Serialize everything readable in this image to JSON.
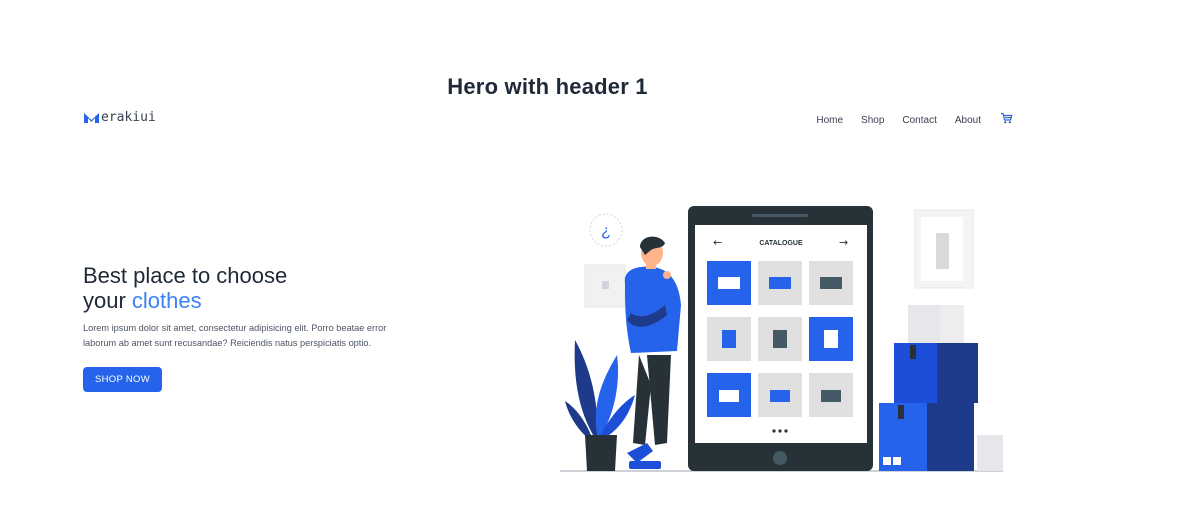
{
  "page": {
    "title": "Hero with header 1"
  },
  "brand": {
    "name_rest": "erakiui",
    "color": "#2563eb"
  },
  "nav": {
    "links": [
      "Home",
      "Shop",
      "Contact",
      "About"
    ],
    "cart_icon": "cart-icon"
  },
  "hero": {
    "headline_line1": "Best place to choose",
    "headline_word": "your",
    "headline_accent": "clothes",
    "description": "Lorem ipsum dolor sit amet, consectetur adipisicing elit. Porro beatae error laborum ab amet sunt recusandae? Reiciendis natus perspiciatis optio.",
    "button_label": "SHOP NOW",
    "accent_color": "#3b82f6",
    "button_color": "#2563eb"
  },
  "illustration": {
    "screen_title": "CATALOGUE",
    "thought_symbol": "¿"
  }
}
